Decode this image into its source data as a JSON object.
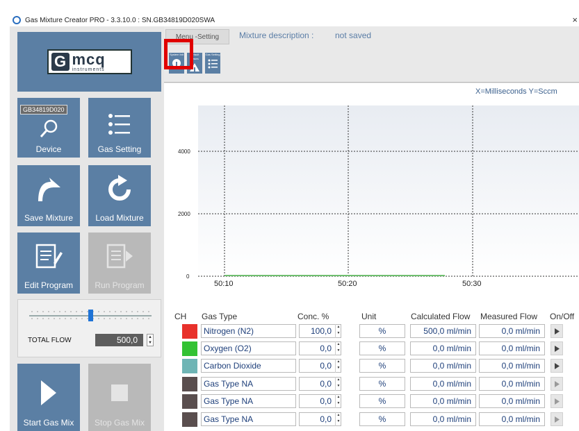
{
  "window": {
    "title": "Gas Mixture Creator PRO - 3.3.10.0 : SN.GB34819D020SWA",
    "close_glyph": "×"
  },
  "logo": {
    "mark": "G",
    "name": "mcq",
    "subtitle": "instruments"
  },
  "left_tiles": {
    "serial": "GB34819D020",
    "device": "Device",
    "gas_setting": "Gas Setting",
    "save_mixture": "Save Mixture",
    "load_mixture": "Load Mixture",
    "edit_program": "Edit Program",
    "run_program": "Run Program",
    "start_gas_mix": "Start Gas Mix",
    "stop_gas_mix": "Stop Gas Mix"
  },
  "flow": {
    "label": "TOTAL FLOW",
    "value": "500,0",
    "slider_level": 0.5
  },
  "toolbar": {
    "tab_label": "Menu -Setting",
    "mixture_label": "Mixture description :",
    "mixture_value": "not saved",
    "buttons": [
      {
        "label": "System Init",
        "icon": "info-icon"
      },
      {
        "label": "Default Gases",
        "icon": "triangle-up-icon"
      },
      {
        "label": "Gas Setting",
        "icon": "list-icon"
      }
    ]
  },
  "chart": {
    "axis_note": "X=Milliseconds Y=Sccm",
    "y_ticks": [
      "4000",
      "2000",
      "0"
    ],
    "x_ticks": [
      "50:10",
      "50:20",
      "50:30"
    ]
  },
  "chart_data": {
    "type": "line",
    "title": "",
    "xlabel": "",
    "ylabel": "",
    "x_ticks": [
      "50:10",
      "50:20",
      "50:30"
    ],
    "ylim": [
      0,
      5200
    ],
    "y_ticks": [
      0,
      2000,
      4000
    ],
    "series": [
      {
        "values": [
          0,
          0,
          0
        ],
        "color": "#6fbf6f"
      }
    ],
    "grid": true
  },
  "table": {
    "headers": {
      "ch": "CH",
      "gas": "Gas Type",
      "conc": "Conc. %",
      "unit": "Unit",
      "calc": "Calculated Flow",
      "meas": "Measured Flow",
      "onoff": "On/Off"
    },
    "rows": [
      {
        "color": "#e8312b",
        "gas": "Nitrogen (N2)",
        "conc": "100,0",
        "unit": "%",
        "calc": "500,0 ml/min",
        "meas": "0,0 ml/min",
        "enabled": true
      },
      {
        "color": "#33c233",
        "gas": "Oxygen (O2)",
        "conc": "0,0",
        "unit": "%",
        "calc": "0,0 ml/min",
        "meas": "0,0 ml/min",
        "enabled": true
      },
      {
        "color": "#6fb5b5",
        "gas": "Carbon Dioxide",
        "conc": "0,0",
        "unit": "%",
        "calc": "0,0 ml/min",
        "meas": "0,0 ml/min",
        "enabled": true
      },
      {
        "color": "#5a4e4e",
        "gas": "Gas Type NA",
        "conc": "0,0",
        "unit": "%",
        "calc": "0,0 ml/min",
        "meas": "0,0 ml/min",
        "enabled": false
      },
      {
        "color": "#5a4e4e",
        "gas": "Gas Type NA",
        "conc": "0,0",
        "unit": "%",
        "calc": "0,0 ml/min",
        "meas": "0,0 ml/min",
        "enabled": false
      },
      {
        "color": "#5a4e4e",
        "gas": "Gas Type NA",
        "conc": "0,0",
        "unit": "%",
        "calc": "0,0 ml/min",
        "meas": "0,0 ml/min",
        "enabled": false
      }
    ]
  }
}
